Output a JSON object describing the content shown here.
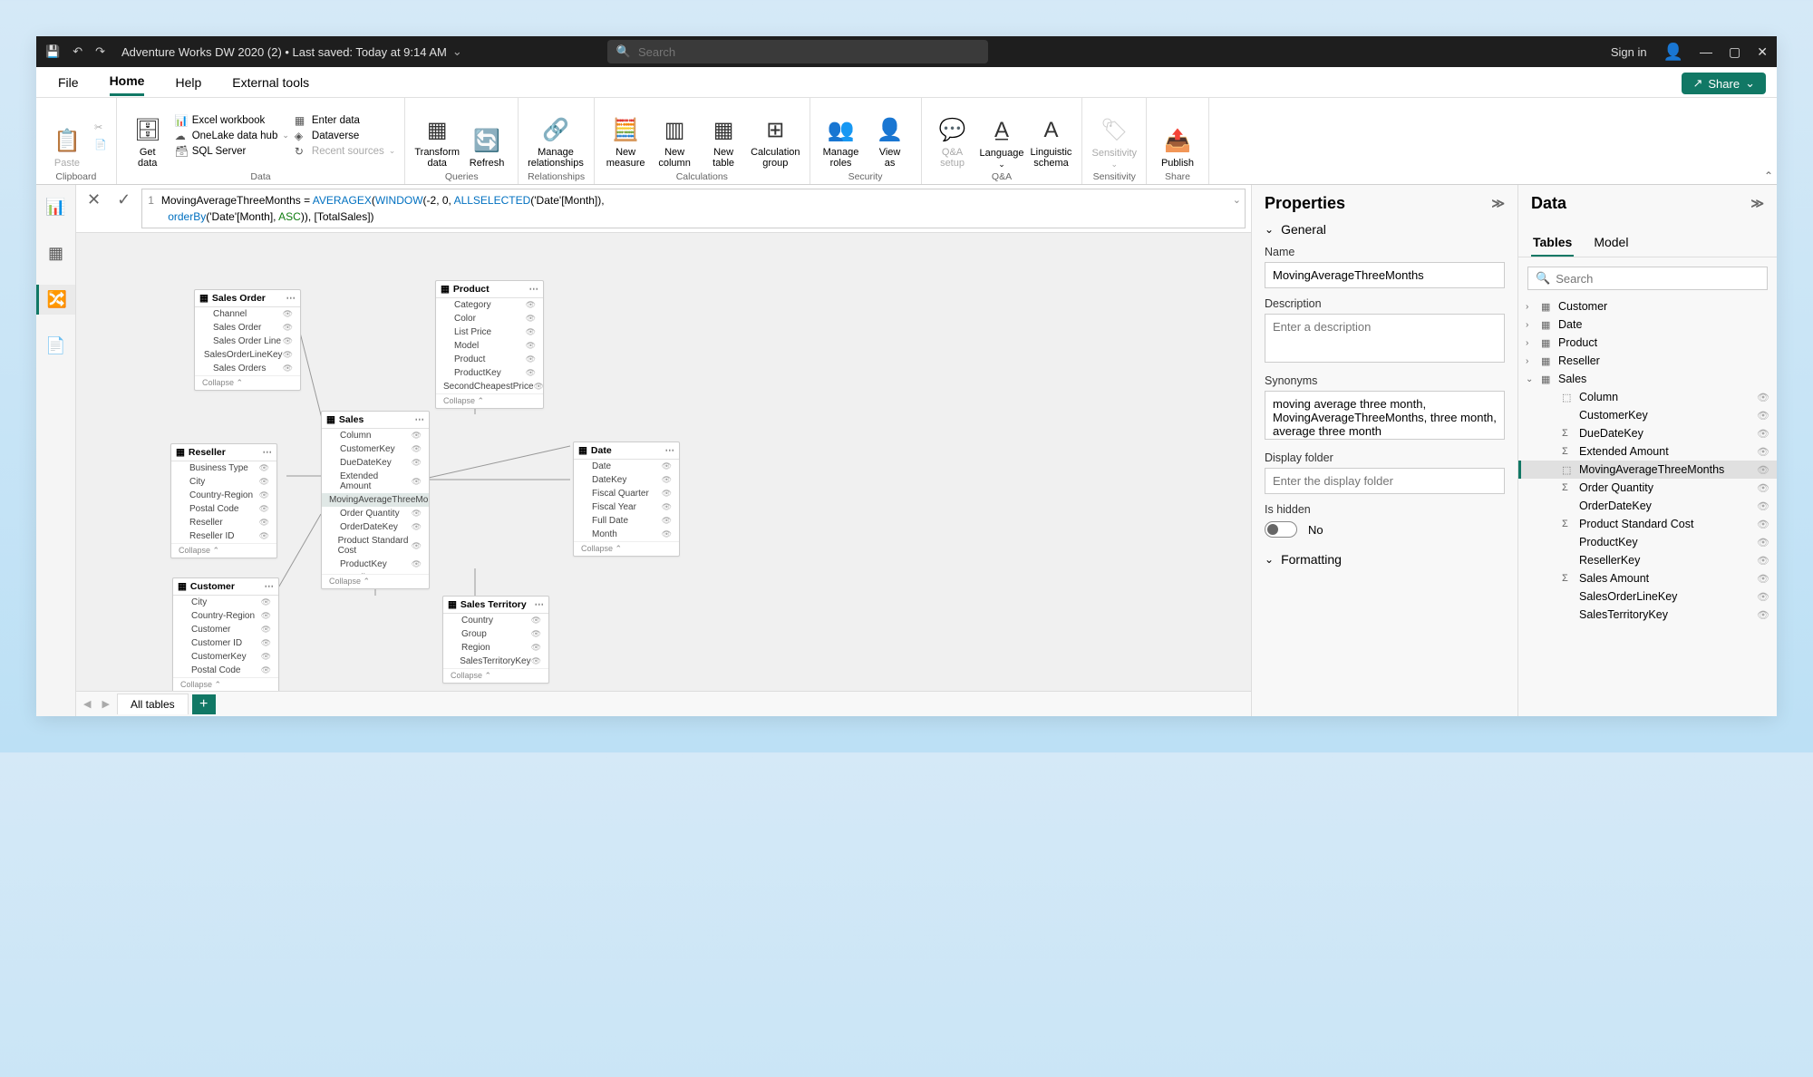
{
  "titlebar": {
    "title": "Adventure Works DW 2020 (2) • Last saved: Today at 9:14 AM",
    "search_placeholder": "Search",
    "signin": "Sign in"
  },
  "menu": {
    "file": "File",
    "home": "Home",
    "help": "Help",
    "external": "External tools",
    "share": "Share"
  },
  "ribbon": {
    "clipboard": {
      "paste": "Paste",
      "group": "Clipboard"
    },
    "data": {
      "get": "Get\ndata",
      "excel": "Excel workbook",
      "onelake": "OneLake data hub",
      "sqlserver": "SQL Server",
      "enter": "Enter data",
      "dataverse": "Dataverse",
      "recent": "Recent sources",
      "group": "Data"
    },
    "queries": {
      "transform": "Transform\ndata",
      "refresh": "Refresh",
      "group": "Queries"
    },
    "relationships": {
      "manage": "Manage\nrelationships",
      "group": "Relationships"
    },
    "calc": {
      "measure": "New\nmeasure",
      "column": "New\ncolumn",
      "table": "New\ntable",
      "cgroup": "Calculation\ngroup",
      "group": "Calculations"
    },
    "security": {
      "roles": "Manage\nroles",
      "viewas": "View\nas",
      "group": "Security"
    },
    "qa": {
      "setup": "Q&A\nsetup",
      "lang": "Language",
      "schema": "Linguistic\nschema",
      "group": "Q&A"
    },
    "sens": {
      "label": "Sensitivity",
      "group": "Sensitivity"
    },
    "share": {
      "publish": "Publish",
      "group": "Share"
    }
  },
  "formula": {
    "line1_pre": "MovingAverageThreeMonths = ",
    "fn1": "AVERAGEX",
    "fn2": "WINDOW",
    "args1": "(-2, 0, ",
    "fn3": "ALLSELECTED",
    "args2": "('Date'[Month]),",
    "line2_pre": "orderBy",
    "args3": "('Date'[Month], ",
    "asc": "ASC",
    "args4": ")), [TotalSales])"
  },
  "tables": {
    "salesorder": {
      "name": "Sales Order",
      "fields": [
        "Channel",
        "Sales Order",
        "Sales Order Line",
        "SalesOrderLineKey",
        "Sales Orders"
      ]
    },
    "product": {
      "name": "Product",
      "fields": [
        "Category",
        "Color",
        "List Price",
        "Model",
        "Product",
        "ProductKey",
        "SecondCheapestPrice"
      ]
    },
    "sales": {
      "name": "Sales",
      "fields": [
        "Column",
        "CustomerKey",
        "DueDateKey",
        "Extended Amount",
        "MovingAverageThreeMonths",
        "Order Quantity",
        "OrderDateKey",
        "Product Standard Cost",
        "ProductKey",
        "ResellerKey"
      ]
    },
    "reseller": {
      "name": "Reseller",
      "fields": [
        "Business Type",
        "City",
        "Country-Region",
        "Postal Code",
        "Reseller",
        "Reseller ID"
      ]
    },
    "date": {
      "name": "Date",
      "fields": [
        "Date",
        "DateKey",
        "Fiscal Quarter",
        "Fiscal Year",
        "Full Date",
        "Month"
      ]
    },
    "customer": {
      "name": "Customer",
      "fields": [
        "City",
        "Country-Region",
        "Customer",
        "Customer ID",
        "CustomerKey",
        "Postal Code"
      ]
    },
    "territory": {
      "name": "Sales Territory",
      "fields": [
        "Country",
        "Group",
        "Region",
        "SalesTerritoryKey"
      ]
    },
    "collapse": "Collapse"
  },
  "tabbar": {
    "alltables": "All tables"
  },
  "props": {
    "title": "Properties",
    "general": "General",
    "name_label": "Name",
    "name_value": "MovingAverageThreeMonths",
    "desc_label": "Description",
    "desc_placeholder": "Enter a description",
    "syn_label": "Synonyms",
    "syn_value": "moving average three month, MovingAverageThreeMonths, three month, average three month",
    "folder_label": "Display folder",
    "folder_placeholder": "Enter the display folder",
    "hidden_label": "Is hidden",
    "hidden_value": "No",
    "formatting": "Formatting"
  },
  "datapane": {
    "title": "Data",
    "tab_tables": "Tables",
    "tab_model": "Model",
    "search": "Search",
    "tables": [
      "Customer",
      "Date",
      "Product",
      "Reseller",
      "Sales"
    ],
    "sales_fields": [
      {
        "name": "Column",
        "ico": "fx",
        "hide": true
      },
      {
        "name": "CustomerKey",
        "ico": "",
        "hide": true
      },
      {
        "name": "DueDateKey",
        "ico": "Σ",
        "hide": true
      },
      {
        "name": "Extended Amount",
        "ico": "Σ",
        "hide": true
      },
      {
        "name": "MovingAverageThreeMonths",
        "ico": "fx",
        "hide": true,
        "selected": true
      },
      {
        "name": "Order Quantity",
        "ico": "Σ",
        "hide": true
      },
      {
        "name": "OrderDateKey",
        "ico": "",
        "hide": true
      },
      {
        "name": "Product Standard Cost",
        "ico": "Σ",
        "hide": true
      },
      {
        "name": "ProductKey",
        "ico": "",
        "hide": true
      },
      {
        "name": "ResellerKey",
        "ico": "",
        "hide": true
      },
      {
        "name": "Sales Amount",
        "ico": "Σ",
        "hide": true
      },
      {
        "name": "SalesOrderLineKey",
        "ico": "",
        "hide": true
      },
      {
        "name": "SalesTerritoryKey",
        "ico": "",
        "hide": true
      }
    ]
  }
}
